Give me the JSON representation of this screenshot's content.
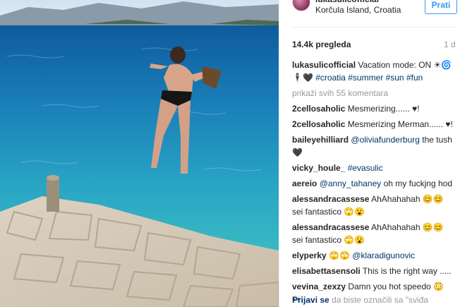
{
  "post": {
    "username": "lukasulicofficial",
    "location": "Korčula Island, Croatia",
    "follow_label": "Prati",
    "views": "14.4k pregleda",
    "time": "1 d"
  },
  "caption": {
    "user": "lukasulicofficial",
    "text": " Vacation mode: ON ☀🌀",
    "line2": "🕴🖤 ",
    "tags": "#croatia #summer #sun #fun"
  },
  "load_more": "prikaži svih 55 komentara",
  "comments": [
    {
      "user": "2cellosaholic",
      "text": " Mesmerizing...... ♥!"
    },
    {
      "user": "2cellosaholic",
      "text": " Mesmerizing Merman...... ♥!"
    },
    {
      "user": "baileyehilliard",
      "mention": " @oliviafunderburg",
      "text": " the tush🖤"
    },
    {
      "user": "vicky_houle_",
      "mention": " #evasulic",
      "text": ""
    },
    {
      "user": "aereio",
      "mention": " @anny_tahaney",
      "text": " oh my fuckjng hod"
    },
    {
      "user": "alessandracassese",
      "text": " AhAhahahah 😊😊 sei fantastico 🙄😮"
    },
    {
      "user": "alessandracassese",
      "text": " AhAhahahah 😊😊 sei fantastico 🙄😮"
    },
    {
      "user": "elyperky",
      "text": " 🙄🙄 ",
      "mention": "@klaradigunovic"
    },
    {
      "user": "elisabettasensoli",
      "text": " This is the right way ....."
    },
    {
      "user": "vevina_zexzy",
      "text": " Damn you hot speedo 😳 👀"
    }
  ],
  "footer": {
    "login": "Prijavi se",
    "text": " da biste označili sa \"sviđa"
  },
  "colors": {
    "link": "#003569",
    "follow": "#3897f0",
    "muted": "#999999",
    "sea": "#1f8fb8"
  }
}
